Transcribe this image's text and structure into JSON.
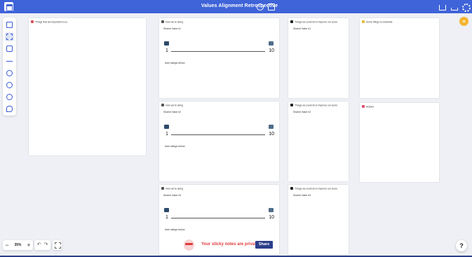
{
  "app": {
    "title": "Values Alignment Retrospective",
    "accent": "#3f63d8",
    "avatar_initials": "M"
  },
  "toolbar": {
    "tools": [
      "panel-icon",
      "select-icon",
      "sticky-icon",
      "arrow-icon",
      "comment-icon",
      "emoji-icon",
      "timer-icon",
      "pen-icon"
    ]
  },
  "cards": {
    "important": {
      "header": "Things that are important to us"
    },
    "doing1": {
      "header": "How we're doing",
      "sub": "Shared Value #1",
      "min": "1",
      "max": "10",
      "add": "Add ratings below"
    },
    "doing2": {
      "header": "How we're doing",
      "sub": "Shared Value #2",
      "min": "1",
      "max": "10",
      "add": "Add ratings below"
    },
    "doing3": {
      "header": "How we're doing",
      "sub": "Shared Value #3",
      "min": "1",
      "max": "10",
      "add": "Add ratings below"
    },
    "improve1": {
      "header": "Things we could do to improve our score",
      "sub": "Shared Value #1"
    },
    "improve2": {
      "header": "Things we could do to improve our score",
      "sub": "Shared Value #2"
    },
    "improve3": {
      "header": "Things we could do to improve our score",
      "sub": "Shared Value #3"
    },
    "celebrate": {
      "header": "Some things to celebrate"
    },
    "actions": {
      "header": "Actions"
    }
  },
  "zoom": {
    "value": "35%",
    "minus": "−",
    "plus": "+"
  },
  "undo": "↶",
  "redo": "↷",
  "private": {
    "text": "Your sticky notes are private",
    "share": "Share"
  },
  "help": "?"
}
